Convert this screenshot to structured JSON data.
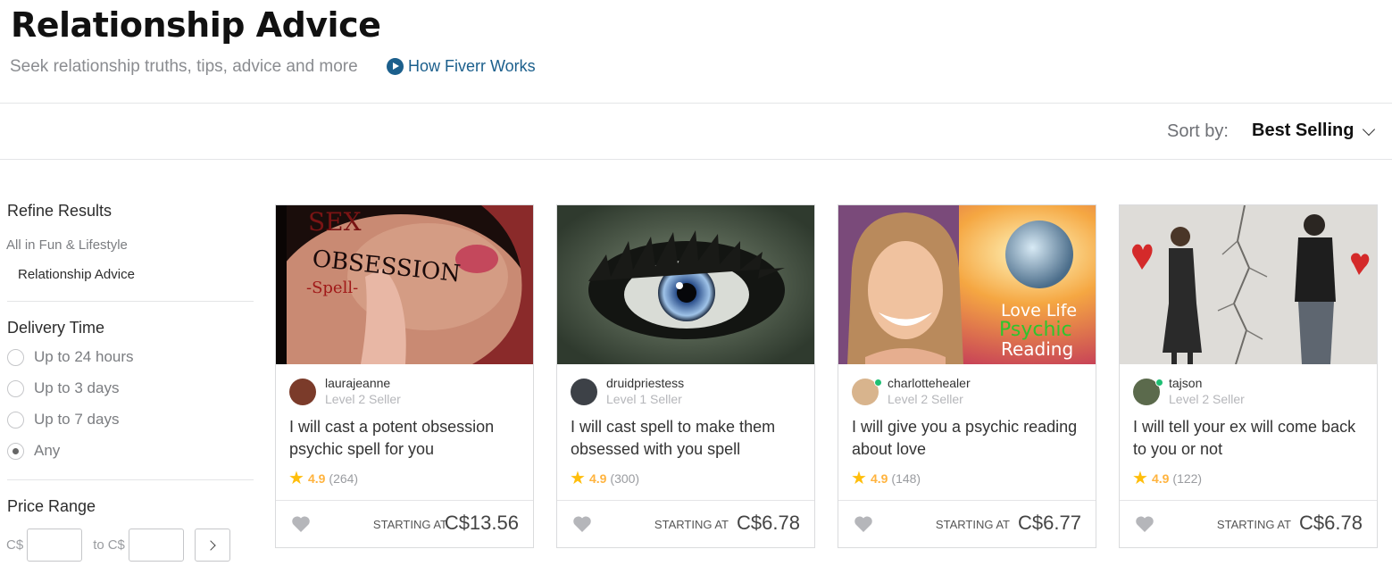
{
  "header": {
    "title": "Relationship Advice",
    "subtitle": "Seek relationship truths, tips, advice and more",
    "how_link": "How Fiverr Works"
  },
  "sort": {
    "label": "Sort by:",
    "value": "Best Selling"
  },
  "sidebar": {
    "refine_title": "Refine Results",
    "parent_category": "All in Fun & Lifestyle",
    "current_category": "Relationship Advice",
    "delivery_title": "Delivery Time",
    "delivery_options": [
      {
        "label": "Up to 24 hours",
        "checked": false
      },
      {
        "label": "Up to 3 days",
        "checked": false
      },
      {
        "label": "Up to 7 days",
        "checked": false
      },
      {
        "label": "Any",
        "checked": true
      }
    ],
    "price_title": "Price Range",
    "currency": "C$",
    "to_label": "to"
  },
  "cards": [
    {
      "image_text": [
        "SEX",
        "OBSESSION",
        "-Spell-"
      ],
      "seller": "laurajeanne",
      "level": "Level 2 Seller",
      "online": false,
      "title": "I will cast a potent obsession psychic spell for you",
      "rating": "4.9",
      "reviews": "(264)",
      "starting_label": "STARTING AT",
      "price": "C$13.56"
    },
    {
      "image_text": [],
      "seller": "druidpriestess",
      "level": "Level 1 Seller",
      "online": false,
      "title": "I will cast spell to make them obsessed with you spell",
      "rating": "4.9",
      "reviews": "(300)",
      "starting_label": "STARTING AT",
      "price": "C$6.78"
    },
    {
      "image_text": [
        "Love Life",
        "Psychic",
        "Reading"
      ],
      "seller": "charlottehealer",
      "level": "Level 2 Seller",
      "online": true,
      "title": "I will give you a psychic reading about love",
      "rating": "4.9",
      "reviews": "(148)",
      "starting_label": "STARTING AT",
      "price": "C$6.77"
    },
    {
      "image_text": [],
      "seller": "tajson",
      "level": "Level 2 Seller",
      "online": true,
      "title": "I will tell your ex will come back to you or not",
      "rating": "4.9",
      "reviews": "(122)",
      "starting_label": "STARTING AT",
      "price": "C$6.78"
    }
  ],
  "colors": {
    "link": "#1b5f8c",
    "star": "#ffbe0b",
    "online": "#1dbf73"
  }
}
